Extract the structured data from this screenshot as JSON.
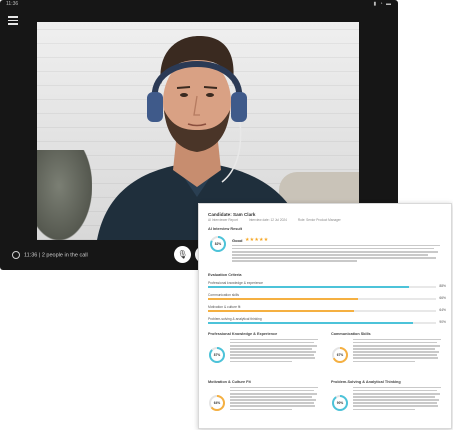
{
  "device": {
    "time": "11:36",
    "status_icons": "▮ ◔ ▬"
  },
  "call": {
    "participants": "11:36 | 2 people in the call",
    "controls": [
      {
        "name": "mic-icon",
        "glyph": "🎙"
      },
      {
        "name": "settings-icon",
        "glyph": "⚙"
      }
    ]
  },
  "report": {
    "title": "Candidate: Sam Clark",
    "meta": [
      "AI Interviewer Report",
      "Interview date: 12 Jul 2024",
      "Role: Senior Product Manager"
    ],
    "result_section": "AI Interview Result",
    "result_label": "Good",
    "stars": "★★★★★",
    "overall_score": "82%",
    "criteria_section": "Evaluation Criteria",
    "criteria": [
      {
        "label": "Professional knowledge & experience",
        "value": 88,
        "pct": "88%",
        "color": "#4cc3d9"
      },
      {
        "label": "Communication skills",
        "value": 66,
        "pct": "66%",
        "color": "#f5b041"
      },
      {
        "label": "Motivation & culture fit",
        "value": 64,
        "pct": "64%",
        "color": "#f5b041"
      },
      {
        "label": "Problem-solving & analytical thinking",
        "value": 90,
        "pct": "90%",
        "color": "#4cc3d9"
      }
    ],
    "details": [
      {
        "title": "Professional Knowledge & Experience",
        "score": "87%",
        "color": "#4cc3d9",
        "value": 0.87
      },
      {
        "title": "Communication Skills",
        "score": "67%",
        "color": "#f5b041",
        "value": 0.67
      },
      {
        "title": "Motivation & Culture Fit",
        "score": "64%",
        "color": "#f5b041",
        "value": 0.64
      },
      {
        "title": "Problem-Solving & Analytical Thinking",
        "score": "90%",
        "color": "#4cc3d9",
        "value": 0.9
      }
    ]
  }
}
